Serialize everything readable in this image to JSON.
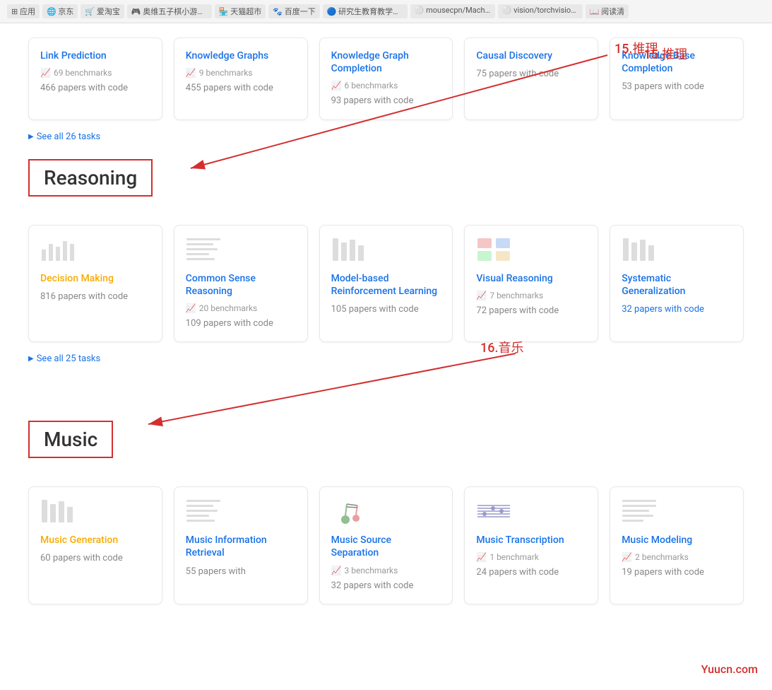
{
  "browser": {
    "tabs": [
      {
        "label": "应用",
        "icon": "grid"
      },
      {
        "label": "京东",
        "active": false
      },
      {
        "label": "爱淘宝",
        "active": false
      },
      {
        "label": "奥维五子棋小游戏...",
        "active": false
      },
      {
        "label": "天猫超市",
        "active": false
      },
      {
        "label": "百度一下",
        "active": false
      },
      {
        "label": "研究生教育教学管...",
        "active": false
      },
      {
        "label": "mousecpn/Machi...",
        "active": false
      },
      {
        "label": "vision/torchvision...",
        "active": false
      },
      {
        "label": "阅读清",
        "active": true
      }
    ]
  },
  "annotations": {
    "reasoning_label": "15.推理",
    "music_label": "16.音乐"
  },
  "top_cards": [
    {
      "title": "Link Prediction",
      "benchmarks": "69 benchmarks",
      "papers": "466 papers with code"
    },
    {
      "title": "Knowledge Graphs",
      "benchmarks": "9 benchmarks",
      "papers": "455 papers with code"
    },
    {
      "title": "Knowledge Graph Completion",
      "benchmarks": "6 benchmarks",
      "papers": "93 papers with code"
    },
    {
      "title": "Causal Discovery",
      "benchmarks": "",
      "papers": "75 papers with code"
    },
    {
      "title": "Knowledge Base Completion",
      "benchmarks": "",
      "papers": "53 papers with code"
    }
  ],
  "see_all_26": "See all 26 tasks",
  "reasoning_section": {
    "title": "Reasoning",
    "cards": [
      {
        "title": "Decision Making",
        "benchmarks": "",
        "papers": "816 papers with code",
        "highlight": true
      },
      {
        "title": "Common Sense Reasoning",
        "benchmarks": "20 benchmarks",
        "papers": "109 papers with code"
      },
      {
        "title": "Model-based Reinforcement Learning",
        "benchmarks": "",
        "papers": "105 papers with code"
      },
      {
        "title": "Visual Reasoning",
        "benchmarks": "7 benchmarks",
        "papers": "72 papers with code"
      },
      {
        "title": "Systematic Generalization",
        "benchmarks": "",
        "papers": "32 papers with code"
      }
    ],
    "see_all": "See all 25 tasks"
  },
  "music_section": {
    "title": "Music",
    "cards": [
      {
        "title": "Music Generation",
        "benchmarks": "",
        "papers": "60 papers with code",
        "highlight": true
      },
      {
        "title": "Music Information Retrieval",
        "benchmarks": "",
        "papers": "55 papers with"
      },
      {
        "title": "Music Source Separation",
        "benchmarks": "3 benchmarks",
        "papers": "32 papers with code"
      },
      {
        "title": "Music Transcription",
        "benchmarks": "1 benchmark",
        "papers": "24 papers with code"
      },
      {
        "title": "Music Modeling",
        "benchmarks": "2 benchmarks",
        "papers": "19 papers with code"
      }
    ]
  },
  "watermark": "Yuucn.com"
}
